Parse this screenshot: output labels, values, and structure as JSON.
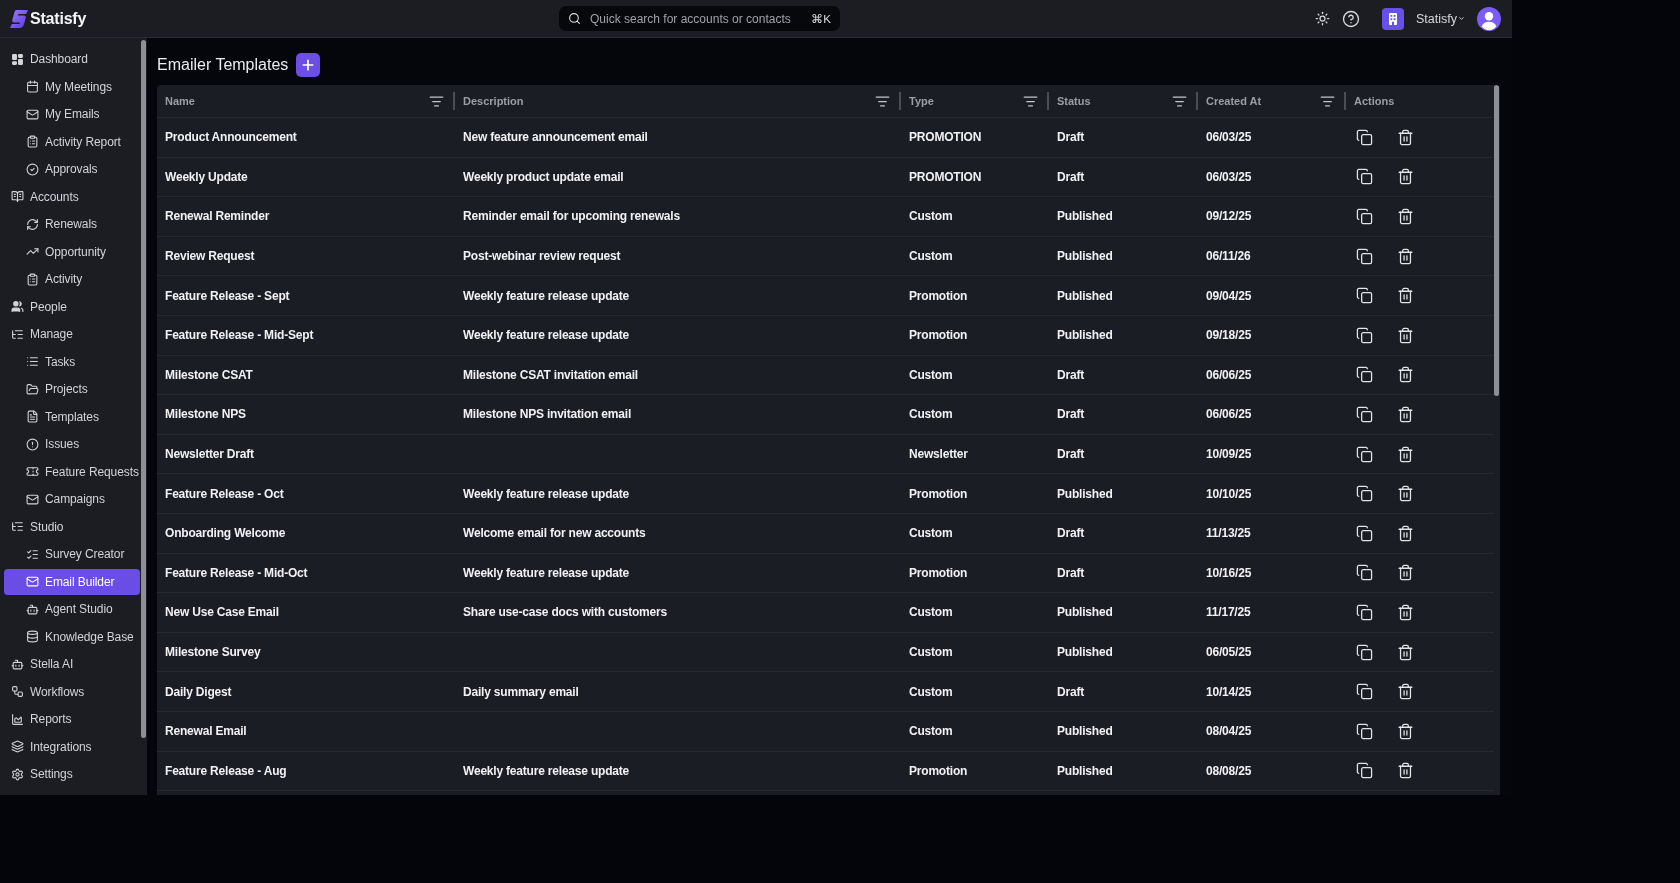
{
  "brand": {
    "name": "Statisfy"
  },
  "search": {
    "placeholder": "Quick search for accounts or contacts",
    "shortcut": "⌘K"
  },
  "account": {
    "name": "Statisfy"
  },
  "sidebar": {
    "items": [
      {
        "label": "Dashboard",
        "selected": false,
        "children": [
          {
            "label": "My Meetings",
            "selected": false
          },
          {
            "label": "My Emails",
            "selected": false
          },
          {
            "label": "Activity Report",
            "selected": false
          },
          {
            "label": "Approvals",
            "selected": false
          }
        ]
      },
      {
        "label": "Accounts",
        "selected": false,
        "children": [
          {
            "label": "Renewals",
            "selected": false
          },
          {
            "label": "Opportunity",
            "selected": false
          },
          {
            "label": "Activity",
            "selected": false
          }
        ]
      },
      {
        "label": "People",
        "selected": false
      },
      {
        "label": "Manage",
        "selected": false,
        "children": [
          {
            "label": "Tasks",
            "selected": false
          },
          {
            "label": "Projects",
            "selected": false
          },
          {
            "label": "Templates",
            "selected": false
          },
          {
            "label": "Issues",
            "selected": false
          },
          {
            "label": "Feature Requests",
            "selected": false
          },
          {
            "label": "Campaigns",
            "selected": false
          }
        ]
      },
      {
        "label": "Studio",
        "selected": false,
        "children": [
          {
            "label": "Survey Creator",
            "selected": false
          },
          {
            "label": "Email Builder",
            "selected": true
          },
          {
            "label": "Agent Studio",
            "selected": false
          },
          {
            "label": "Knowledge Base",
            "selected": false
          }
        ]
      },
      {
        "label": "Stella AI",
        "selected": false
      },
      {
        "label": "Workflows",
        "selected": false
      },
      {
        "label": "Reports",
        "selected": false
      },
      {
        "label": "Integrations",
        "selected": false
      },
      {
        "label": "Settings",
        "selected": false
      }
    ]
  },
  "page": {
    "title": "Emailer Templates"
  },
  "table": {
    "columns": [
      {
        "label": "Name",
        "filterable": true
      },
      {
        "label": "Description",
        "filterable": true
      },
      {
        "label": "Type",
        "filterable": true
      },
      {
        "label": "Status",
        "filterable": true
      },
      {
        "label": "Created At",
        "filterable": true
      },
      {
        "label": "Actions",
        "filterable": false
      }
    ],
    "rows": [
      {
        "name": "Product Announcement",
        "description": "New feature announcement email",
        "type": "PROMOTION",
        "status": "Draft",
        "created_at": "06/03/25"
      },
      {
        "name": "Weekly Update",
        "description": "Weekly product update email",
        "type": "PROMOTION",
        "status": "Draft",
        "created_at": "06/03/25"
      },
      {
        "name": "Renewal Reminder",
        "description": "Reminder email for upcoming renewals",
        "type": "Custom",
        "status": "Published",
        "created_at": "09/12/25"
      },
      {
        "name": "Review Request",
        "description": "Post-webinar review request",
        "type": "Custom",
        "status": "Published",
        "created_at": "06/11/26"
      },
      {
        "name": "Feature Release - Sept",
        "description": "Weekly feature release update",
        "type": "Promotion",
        "status": "Published",
        "created_at": "09/04/25"
      },
      {
        "name": "Feature Release - Mid-Sept",
        "description": "Weekly feature release update",
        "type": "Promotion",
        "status": "Published",
        "created_at": "09/18/25"
      },
      {
        "name": "Milestone CSAT",
        "description": "Milestone CSAT invitation email",
        "type": "Custom",
        "status": "Draft",
        "created_at": "06/06/25"
      },
      {
        "name": "Milestone NPS",
        "description": "Milestone NPS invitation email",
        "type": "Custom",
        "status": "Draft",
        "created_at": "06/06/25"
      },
      {
        "name": "Newsletter Draft",
        "type": "Newsletter",
        "status": "Draft",
        "created_at": "10/09/25"
      },
      {
        "name": "Feature Release - Oct",
        "description": "Weekly feature release update",
        "type": "Promotion",
        "status": "Published",
        "created_at": "10/10/25"
      },
      {
        "name": "Onboarding Welcome",
        "description": "Welcome email for new accounts",
        "type": "Custom",
        "status": "Draft",
        "created_at": "11/13/25"
      },
      {
        "name": "Feature Release - Mid-Oct",
        "description": "Weekly feature release update",
        "type": "Promotion",
        "status": "Draft",
        "created_at": "10/16/25"
      },
      {
        "name": "New Use Case Email",
        "description": "Share use-case docs with customers",
        "type": "Custom",
        "status": "Published",
        "created_at": "11/17/25"
      },
      {
        "name": "Milestone Survey",
        "type": "Custom",
        "status": "Published",
        "created_at": "06/05/25"
      },
      {
        "name": "Daily Digest",
        "description": "Daily summary email",
        "type": "Custom",
        "status": "Draft",
        "created_at": "10/14/25"
      },
      {
        "name": "Renewal Email",
        "type": "Custom",
        "status": "Published",
        "created_at": "08/04/25"
      },
      {
        "name": "Feature Release - Aug",
        "description": "Weekly feature release update",
        "type": "Promotion",
        "status": "Published",
        "created_at": "08/08/25"
      }
    ]
  }
}
